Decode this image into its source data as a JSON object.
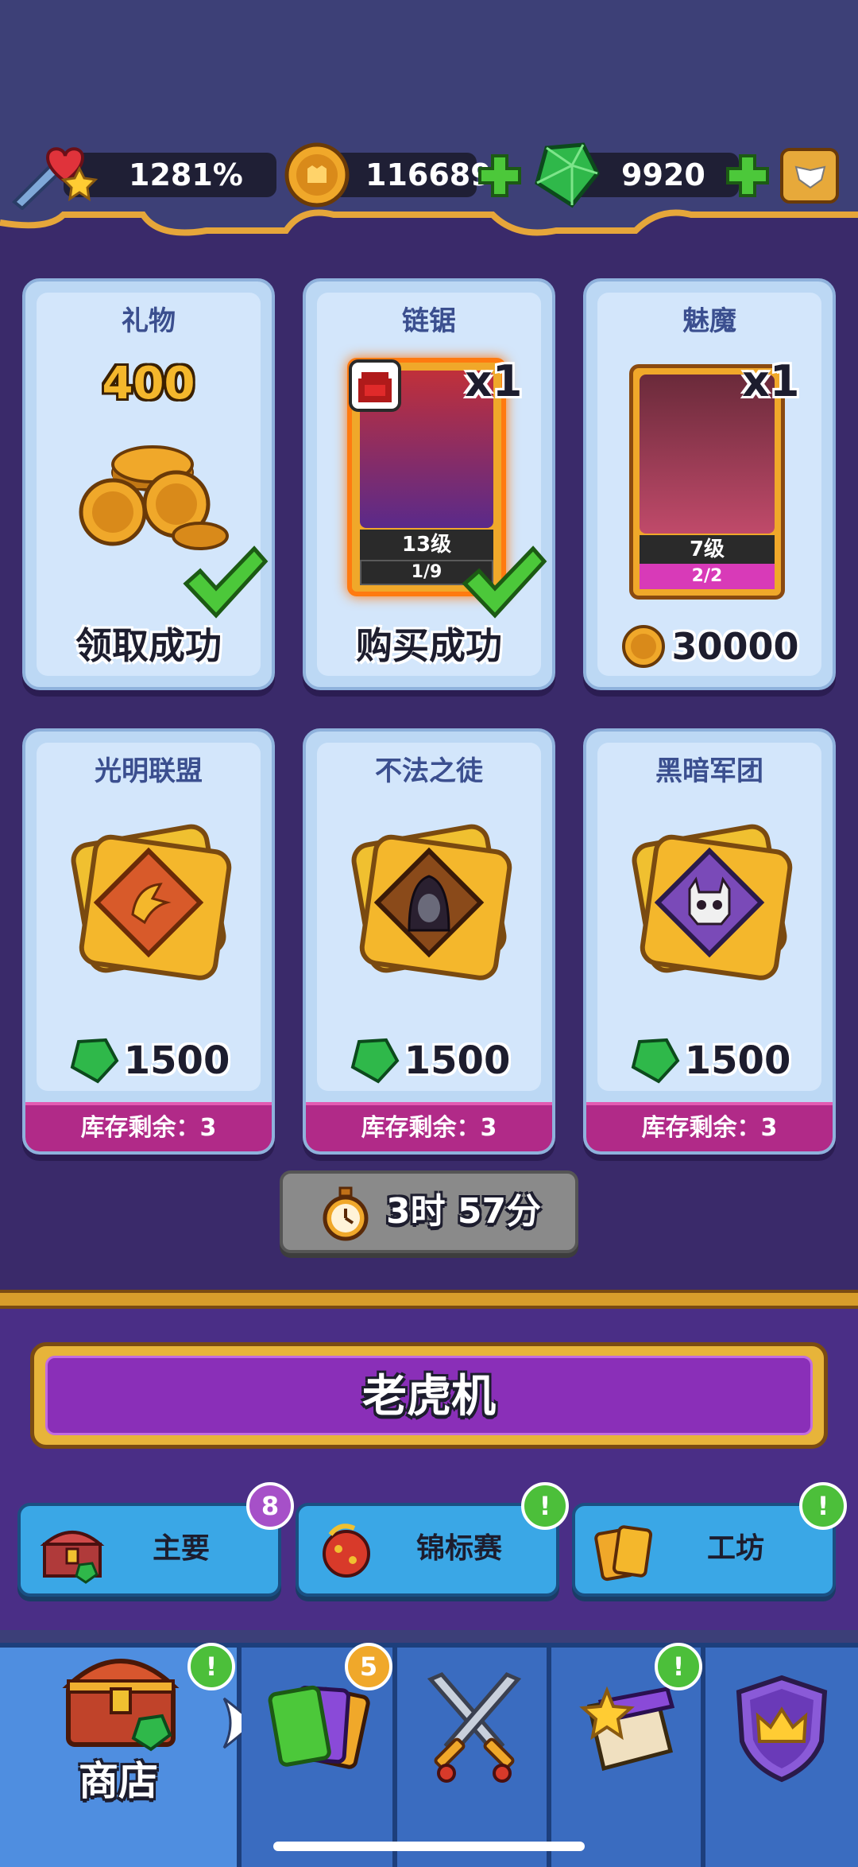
{
  "hud": {
    "power_percent": "1281%",
    "coins": "116689",
    "gems": "9920"
  },
  "offers_row1": [
    {
      "title": "礼物",
      "amount": "400",
      "status": "领取成功"
    },
    {
      "title": "链锯",
      "count": "x1",
      "level": "13级",
      "progress": "1/9",
      "status": "购买成功"
    },
    {
      "title": "魅魔",
      "count": "x1",
      "level": "7级",
      "progress": "2/2",
      "price": "30000"
    }
  ],
  "offers_row2": [
    {
      "title": "光明联盟",
      "price": "1500",
      "stock": "库存剩余：3"
    },
    {
      "title": "不法之徒",
      "price": "1500",
      "stock": "库存剩余：3"
    },
    {
      "title": "黑暗军团",
      "price": "1500",
      "stock": "库存剩余：3"
    }
  ],
  "timer": "3时 57分",
  "slot_machine": "老虎机",
  "sub_tabs": [
    {
      "label": "主要",
      "badge": "8"
    },
    {
      "label": "锦标赛",
      "badge": "!"
    },
    {
      "label": "工坊",
      "badge": "!"
    }
  ],
  "nav": {
    "shop_label": "商店",
    "shop_badge": "!",
    "cards_badge": "5",
    "hero_badge": "!"
  },
  "colors": {
    "panel": "#3a2a6a",
    "card": "#d3e6fb",
    "stock_bar": "#b12a88",
    "gem_green": "#2fb84a",
    "coin_gold": "#e8a02a",
    "badge_purple": "#a650c8",
    "badge_green": "#4cbf3a"
  }
}
